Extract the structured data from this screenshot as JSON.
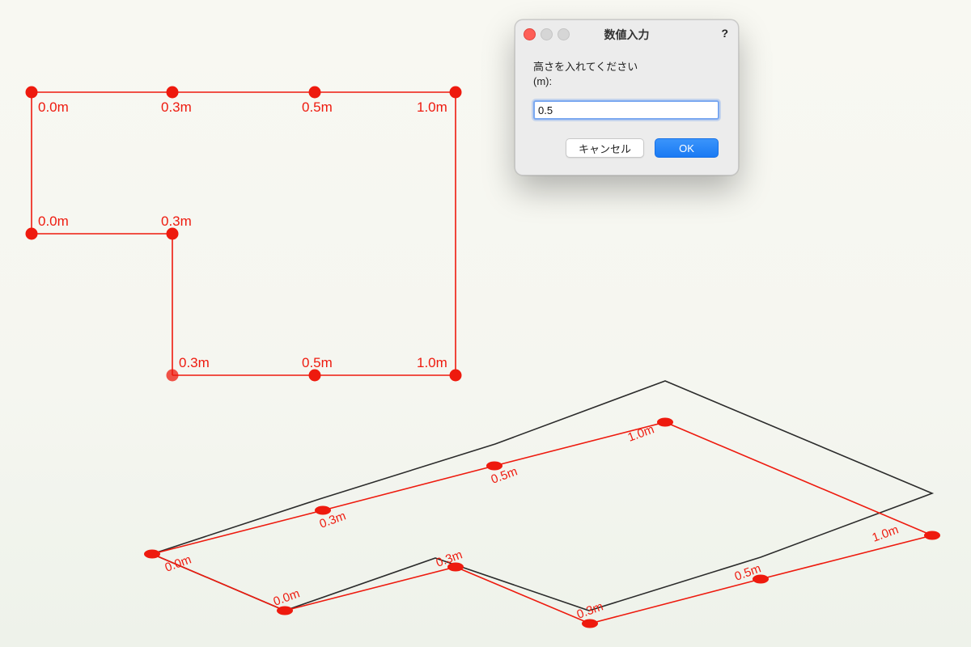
{
  "dialog": {
    "title": "数値入力",
    "help": "?",
    "prompt": "高さを入れてください\n(m):",
    "input_value": "0.5",
    "cancel_label": "キャンセル",
    "ok_label": "OK"
  },
  "plan": {
    "vertices": [
      {
        "label": "0.0m"
      },
      {
        "label": "0.3m"
      },
      {
        "label": "0.5m"
      },
      {
        "label": "1.0m"
      },
      {
        "label": "0.0m"
      },
      {
        "label": "0.3m"
      },
      {
        "label": "0.3m"
      },
      {
        "label": "0.5m"
      },
      {
        "label": "1.0m"
      }
    ]
  },
  "iso": {
    "vertices": [
      {
        "label": "0.0m"
      },
      {
        "label": "0.3m"
      },
      {
        "label": "0.5m"
      },
      {
        "label": "1.0m"
      },
      {
        "label": "1.0m"
      },
      {
        "label": "0.5m"
      },
      {
        "label": "0.3m"
      },
      {
        "label": "0.3m"
      },
      {
        "label": "0.0m"
      }
    ]
  },
  "colors": {
    "accent": "#ee1a0e",
    "outline": "#2b2b2b",
    "ok_button": "#1a7af3"
  }
}
